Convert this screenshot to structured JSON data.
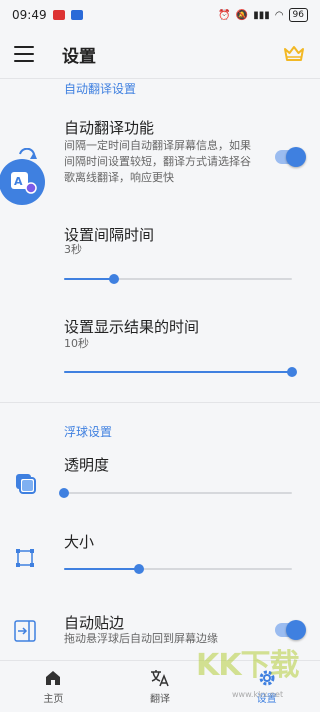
{
  "status_bar": {
    "time": "09:49",
    "battery": "96"
  },
  "app_bar": {
    "title": "设置"
  },
  "auto_translate_section": {
    "header": "自动翻译设置",
    "auto_translate": {
      "title": "自动翻译功能",
      "description": "间隔一定时间自动翻译屏幕信息，如果间隔时间设置较短，翻译方式请选择谷歌离线翻译，响应更快",
      "enabled": true
    },
    "interval": {
      "title": "设置间隔时间",
      "value": "3秒",
      "slider_fraction": 0.22
    },
    "display_time": {
      "title": "设置显示结果的时间",
      "value": "10秒",
      "slider_fraction": 1.0
    }
  },
  "float_ball_section": {
    "header": "浮球设置",
    "opacity": {
      "title": "透明度",
      "slider_fraction": 0.0
    },
    "size": {
      "title": "大小",
      "slider_fraction": 0.33
    },
    "auto_edge": {
      "title": "自动贴边",
      "description": "拖动悬浮球后自动回到屏幕边缘",
      "enabled": true
    }
  },
  "bottom_nav": {
    "items": [
      {
        "label": "主页",
        "icon": "home-icon"
      },
      {
        "label": "翻译",
        "icon": "translate-icon"
      },
      {
        "label": "设置",
        "icon": "gear-icon",
        "active": true
      }
    ]
  },
  "watermark": {
    "text": "KK下载",
    "url": "www.kkx.net"
  },
  "colors": {
    "accent": "#3f80e0",
    "background": "#f5f6f8",
    "crown": "#f2b824"
  }
}
